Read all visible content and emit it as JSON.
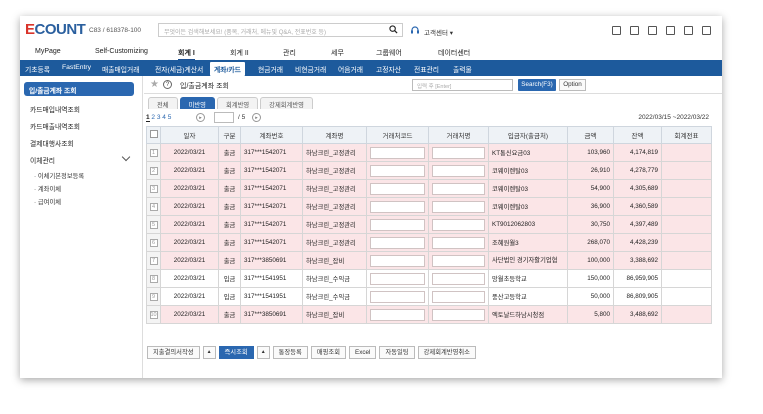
{
  "app": {
    "logo_main": "COUNT",
    "logo_e": "E",
    "company": "C83 / 618378-100",
    "search_placeholder": "무엇이든 검색해보세요! (품목, 거래처, 메뉴및 Q&A, 전표번호 등)",
    "support": "고객센터 ▾"
  },
  "menu": [
    "MyPage",
    "Self-Customizing",
    "회계 I",
    "회계 II",
    "관리",
    "세무",
    "그룹웨어",
    "데이터센터"
  ],
  "submenu": [
    "기초등록",
    "FastEntry",
    "매출매입거래",
    "전자(세금)계산서",
    "계좌/카드",
    "현금거래",
    "비현금거래",
    "어음거래",
    "고정자산",
    "전표관리",
    "출력물"
  ],
  "sidebar": {
    "active": "입/출금계좌 조회",
    "items": [
      "카드매입내역조회",
      "카드매출내역조회",
      "결제대행사조회",
      "이체관리"
    ],
    "subs": [
      "이체기본정보등록",
      "계좌이체",
      "급여이체"
    ]
  },
  "content": {
    "title": "입/출금계좌 조회",
    "input_placeholder": "입력 후 [Enter]",
    "search_btn": "Search(F3)",
    "option_btn": "Option",
    "tabs": [
      "전체",
      "미반영",
      "회계반영",
      "강제회계반영"
    ],
    "pager": {
      "pages": "1 2 3 4 5",
      "total": "/ 5"
    },
    "date_range": "2022/03/15 ~2022/03/22"
  },
  "table": {
    "headers": [
      "일자",
      "구분",
      "계좌번호",
      "계좌명",
      "거래처코드",
      "거래처명",
      "입금자(출금처)",
      "금액",
      "잔액",
      "회계전표"
    ],
    "rows": [
      {
        "n": "1",
        "date": "2022/03/21",
        "type": "출금",
        "acct": "317***1542071",
        "name": "하남크린_고정관리",
        "payee": "KT통신요금03",
        "amount": "103,960",
        "balance": "4,174,819"
      },
      {
        "n": "2",
        "date": "2022/03/21",
        "type": "출금",
        "acct": "317***1542071",
        "name": "하남크린_고정관리",
        "payee": "코웨이렌탈03",
        "amount": "26,910",
        "balance": "4,278,779"
      },
      {
        "n": "3",
        "date": "2022/03/21",
        "type": "출금",
        "acct": "317***1542071",
        "name": "하남크린_고정관리",
        "payee": "코웨이렌탈03",
        "amount": "54,900",
        "balance": "4,305,689"
      },
      {
        "n": "4",
        "date": "2022/03/21",
        "type": "출금",
        "acct": "317***1542071",
        "name": "하남크린_고정관리",
        "payee": "코웨이렌탈03",
        "amount": "36,900",
        "balance": "4,360,589"
      },
      {
        "n": "5",
        "date": "2022/03/21",
        "type": "출금",
        "acct": "317***1542071",
        "name": "하남크린_고정관리",
        "payee": "KT9012062803",
        "amount": "30,750",
        "balance": "4,397,489"
      },
      {
        "n": "6",
        "date": "2022/03/21",
        "type": "출금",
        "acct": "317***1542071",
        "name": "하남크린_고정관리",
        "payee": "조혜원월3",
        "amount": "268,070",
        "balance": "4,428,239"
      },
      {
        "n": "7",
        "date": "2022/03/21",
        "type": "출금",
        "acct": "317***3850691",
        "name": "하남크린_잡비",
        "payee": "사단법인 경기자활기업협",
        "amount": "100,000",
        "balance": "3,388,692"
      },
      {
        "n": "8",
        "date": "2022/03/21",
        "type": "입금",
        "acct": "317***1541951",
        "name": "하남크린_수익금",
        "payee": "망월초등학교",
        "amount": "150,000",
        "balance": "86,959,905"
      },
      {
        "n": "9",
        "date": "2022/03/21",
        "type": "입금",
        "acct": "317***1541951",
        "name": "하남크린_수익금",
        "payee": "풍산고등학교",
        "amount": "50,000",
        "balance": "86,809,905"
      },
      {
        "n": "10",
        "date": "2022/03/21",
        "type": "출금",
        "acct": "317***3850691",
        "name": "하남크린_잡비",
        "payee": "엑토날드하남시청점",
        "amount": "5,800",
        "balance": "3,488,692"
      }
    ]
  },
  "bottom": [
    "지출결의서작성",
    "▲",
    "즉시조회",
    "▲",
    "통장등록",
    "매핑조회",
    "Excel",
    "자동일팅",
    "강제회계반영취소"
  ]
}
